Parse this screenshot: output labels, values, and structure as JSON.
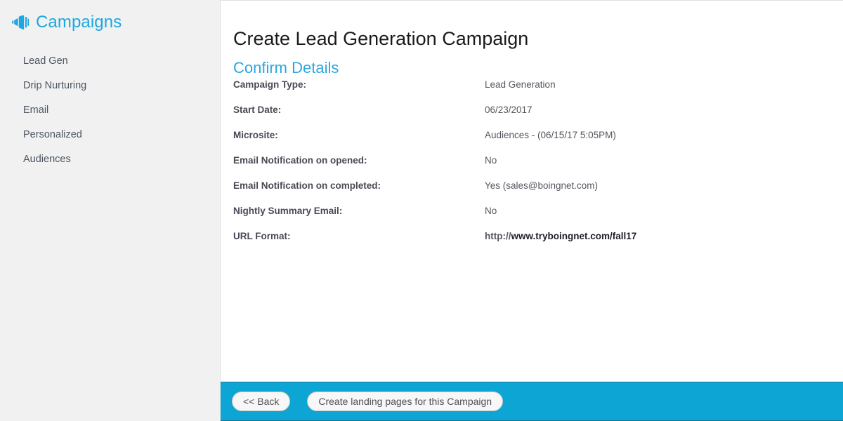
{
  "sidebar": {
    "icon": "megaphone-icon",
    "title": "Campaigns",
    "items": [
      {
        "label": "Lead Gen"
      },
      {
        "label": "Drip Nurturing"
      },
      {
        "label": "Email"
      },
      {
        "label": "Personalized"
      },
      {
        "label": "Audiences"
      }
    ]
  },
  "main": {
    "title": "Create Lead Generation Campaign",
    "subtitle": "Confirm Details",
    "details": [
      {
        "label": "Campaign Type:",
        "value": "Lead Generation"
      },
      {
        "label": "Start Date:",
        "value": "06/23/2017"
      },
      {
        "label": "Microsite:",
        "value": "Audiences - (06/15/17 5:05PM)"
      },
      {
        "label": "Email Notification on opened:",
        "value": "No"
      },
      {
        "label": "Email Notification on completed:",
        "value": "Yes (sales@boingnet.com)"
      },
      {
        "label": "Nightly Summary Email:",
        "value": "No"
      }
    ],
    "url_row": {
      "label": "URL Format:",
      "scheme": "http://",
      "host": "www.tryboingnet.com/fall17"
    }
  },
  "footer": {
    "back_label": "<< Back",
    "create_label": "Create landing pages for this Campaign"
  },
  "colors": {
    "accent": "#1ca7e0",
    "subtitle": "#2ba6de",
    "footer_bar": "#0da5d3",
    "sidebar_bg": "#f1f1f1"
  }
}
